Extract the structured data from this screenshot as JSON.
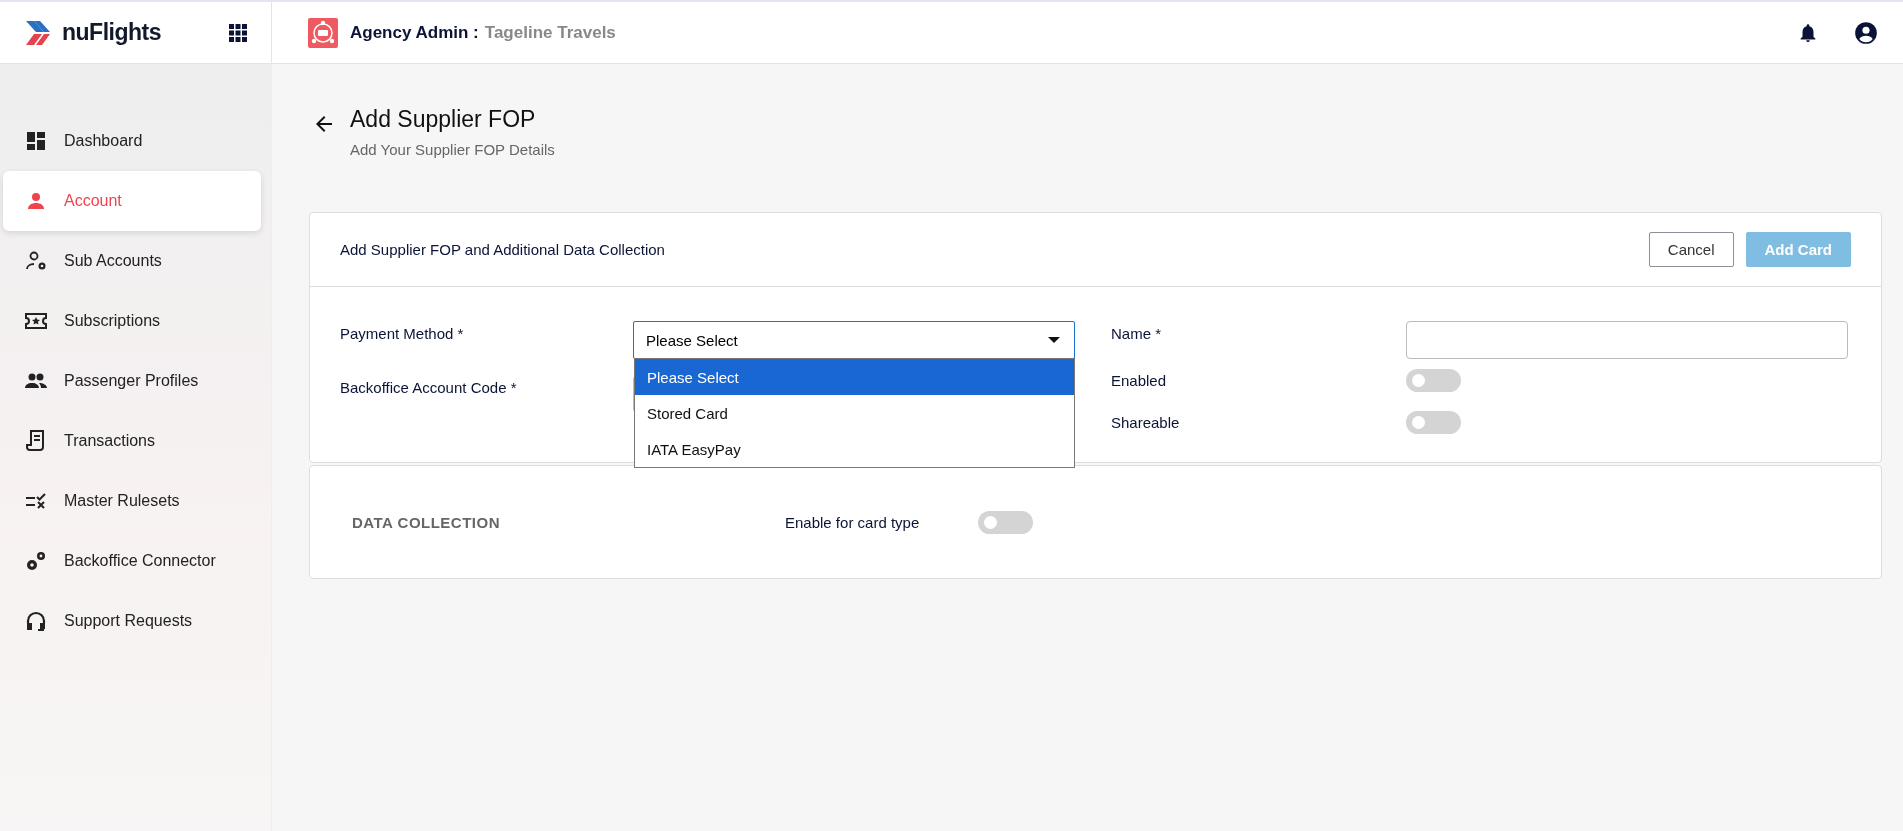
{
  "brand": {
    "name": "nuFlights"
  },
  "header": {
    "role": "Agency Admin :",
    "agency": "Tageline Travels"
  },
  "sidebar": {
    "items": [
      {
        "label": "Dashboard",
        "selected": false
      },
      {
        "label": "Account",
        "selected": true
      },
      {
        "label": "Sub Accounts",
        "selected": false
      },
      {
        "label": "Subscriptions",
        "selected": false
      },
      {
        "label": "Passenger Profiles",
        "selected": false
      },
      {
        "label": "Transactions",
        "selected": false
      },
      {
        "label": "Master Rulesets",
        "selected": false
      },
      {
        "label": "Backoffice Connector",
        "selected": false
      },
      {
        "label": "Support Requests",
        "selected": false
      }
    ]
  },
  "page": {
    "title": "Add Supplier FOP",
    "subtitle": "Add Your Supplier FOP Details"
  },
  "form_card": {
    "title": "Add Supplier FOP and Additional Data Collection",
    "buttons": [
      {
        "label": "Cancel",
        "kind": "outline",
        "disabled": false
      },
      {
        "label": "Add Card",
        "kind": "primary",
        "disabled": true
      }
    ],
    "payment_method": {
      "label": "Payment Method *",
      "value": "Please Select",
      "expanded": true,
      "options": [
        {
          "label": "Please Select",
          "selected": true
        },
        {
          "label": "Stored Card",
          "selected": false
        },
        {
          "label": "IATA EasyPay",
          "selected": false
        }
      ]
    },
    "backoffice_account_code": {
      "label": "Backoffice Account Code *"
    },
    "name": {
      "label": "Name *"
    },
    "enabled": {
      "label": "Enabled",
      "on": false
    },
    "shareable": {
      "label": "Shareable",
      "on": false
    }
  },
  "data_collection": {
    "title": "DATA COLLECTION",
    "toggle": {
      "label": "Enable for card type",
      "on": false
    }
  }
}
